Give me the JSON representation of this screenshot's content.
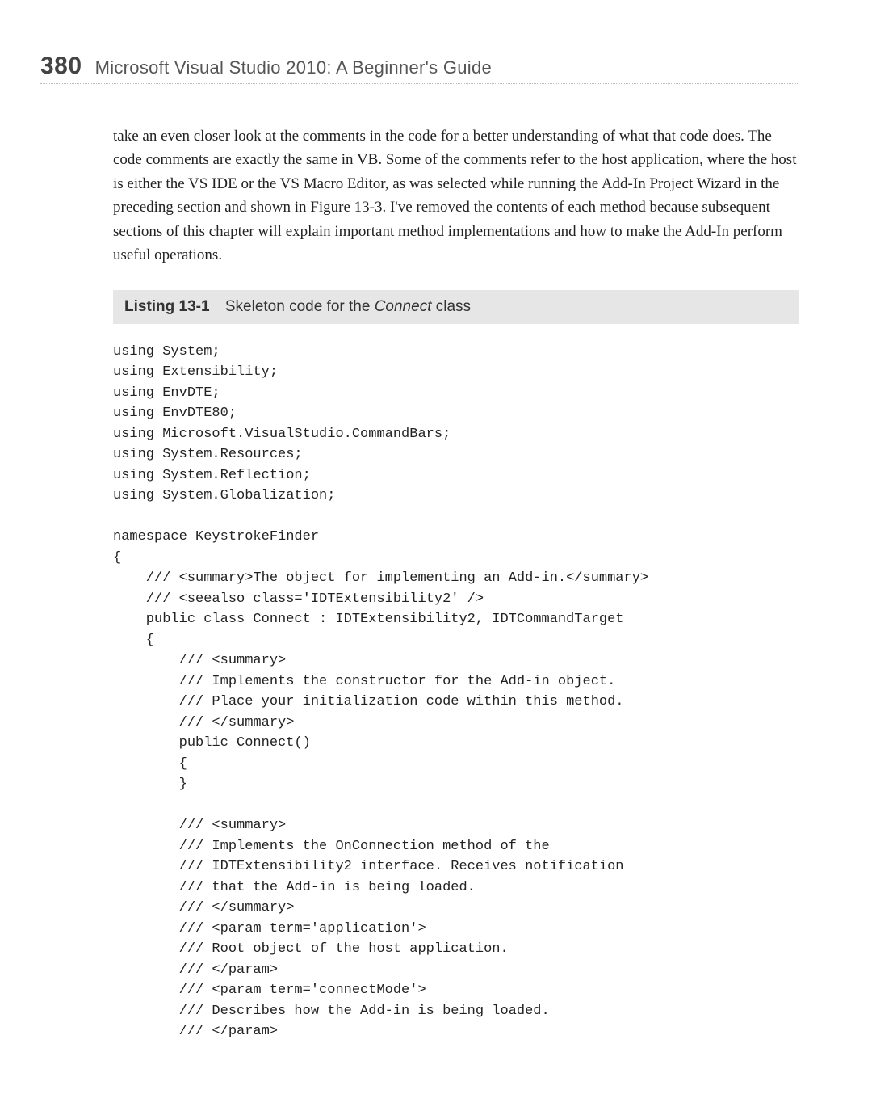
{
  "header": {
    "page_number": "380",
    "book_title": "Microsoft Visual Studio 2010: A Beginner's Guide"
  },
  "body_paragraph": "take an even closer look at the comments in the code for a better understanding of what that code does. The code comments are exactly the same in VB. Some of the comments refer to the host application, where the host is either the VS IDE or the VS Macro Editor, as was selected while running the Add-In Project Wizard in the preceding section and shown in Figure 13-3. I've removed the contents of each method because subsequent sections of this chapter will explain important method implementations and how to make the Add-In perform useful operations.",
  "listing": {
    "label": "Listing 13-1",
    "desc_before": "Skeleton code for the ",
    "desc_em": "Connect",
    "desc_after": " class"
  },
  "code": "using System;\nusing Extensibility;\nusing EnvDTE;\nusing EnvDTE80;\nusing Microsoft.VisualStudio.CommandBars;\nusing System.Resources;\nusing System.Reflection;\nusing System.Globalization;\n\nnamespace KeystrokeFinder\n{\n    /// <summary>The object for implementing an Add-in.</summary>\n    /// <seealso class='IDTExtensibility2' />\n    public class Connect : IDTExtensibility2, IDTCommandTarget\n    {\n        /// <summary>\n        /// Implements the constructor for the Add-in object.\n        /// Place your initialization code within this method.\n        /// </summary>\n        public Connect()\n        {\n        }\n\n        /// <summary>\n        /// Implements the OnConnection method of the\n        /// IDTExtensibility2 interface. Receives notification\n        /// that the Add-in is being loaded.\n        /// </summary>\n        /// <param term='application'>\n        /// Root object of the host application.\n        /// </param>\n        /// <param term='connectMode'>\n        /// Describes how the Add-in is being loaded.\n        /// </param>"
}
